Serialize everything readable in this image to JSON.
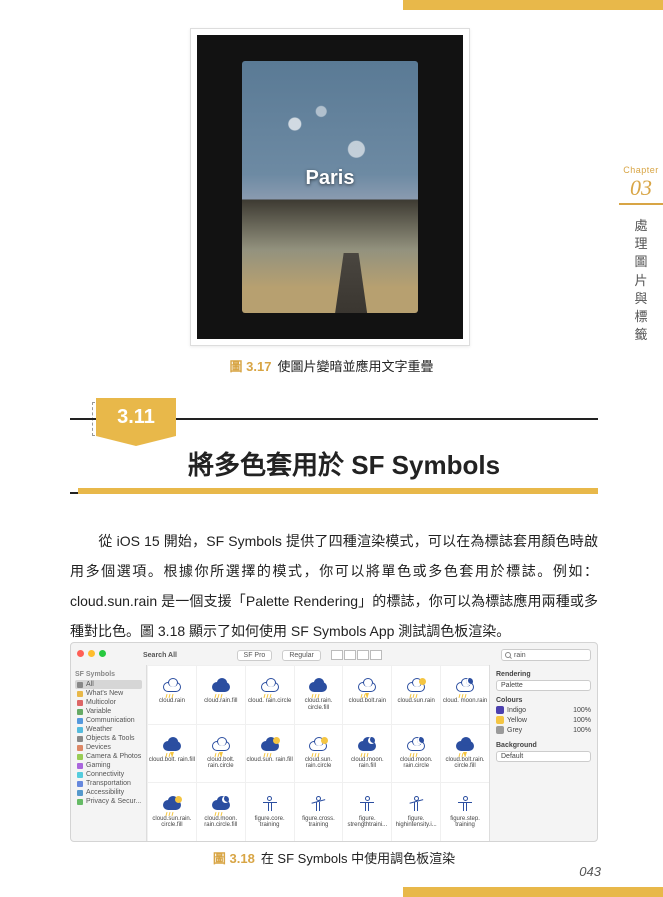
{
  "chapter": {
    "label": "Chapter",
    "num": "03",
    "title_chars": [
      "處",
      "理",
      "圖",
      "片",
      "與",
      "標",
      "籤"
    ]
  },
  "figure_3_17": {
    "overlay_text": "Paris",
    "label": "圖 3.17",
    "caption": "使圖片變暗並應用文字重疊"
  },
  "section": {
    "number": "3.11",
    "title": "將多色套用於 SF Symbols"
  },
  "body": "　　從 iOS 15 開始，SF Symbols 提供了四種渲染模式，可以在為標誌套用顏色時啟用多個選項。根據你所選擇的模式，你可以將單色或多色套用於標誌。例如：cloud.sun.rain 是一個支援「Palette Rendering」的標誌，你可以為標誌應用兩種或多種對比色。圖 3.18 顯示了如何使用 SF Symbols App 測試調色板渲染。",
  "sf_app": {
    "search_title": "Search All",
    "font": "SF Pro",
    "weight": "Regular",
    "search": "rain",
    "sidebar_header": "SF Symbols",
    "sidebar_items": [
      {
        "label": "All",
        "color": "#888",
        "selected": true
      },
      {
        "label": "What's New",
        "color": "#e8b84a"
      },
      {
        "label": "Multicolor",
        "color": "#d66"
      },
      {
        "label": "Variable",
        "color": "#6a6"
      },
      {
        "label": "Communication",
        "color": "#59d"
      },
      {
        "label": "Weather",
        "color": "#5bd"
      },
      {
        "label": "Objects & Tools",
        "color": "#888"
      },
      {
        "label": "Devices",
        "color": "#d86"
      },
      {
        "label": "Camera & Photos",
        "color": "#9c5"
      },
      {
        "label": "Gaming",
        "color": "#a6d"
      },
      {
        "label": "Connectivity",
        "color": "#5cd"
      },
      {
        "label": "Transportation",
        "color": "#68d"
      },
      {
        "label": "Accessibility",
        "color": "#59c"
      },
      {
        "label": "Privacy & Secur...",
        "color": "#6b6"
      }
    ],
    "grid": [
      {
        "name": "cloud.rain",
        "cloud": true,
        "rain": true
      },
      {
        "name": "cloud.rain.fill",
        "cloud": true,
        "rain": true,
        "fill": true
      },
      {
        "name": "cloud. rain.circle",
        "cloud": true,
        "rain": true
      },
      {
        "name": "cloud.rain. circle.fill",
        "cloud": true,
        "rain": true,
        "fill": true
      },
      {
        "name": "cloud.bolt.rain",
        "cloud": true,
        "bolt": true,
        "rain": true
      },
      {
        "name": "cloud.sun.rain",
        "cloud": true,
        "sun": true,
        "rain": true
      },
      {
        "name": "cloud. moon.rain",
        "cloud": true,
        "moon": true,
        "rain": true
      },
      {
        "name": "cloud.bolt. rain.fill",
        "cloud": true,
        "bolt": true,
        "rain": true,
        "fill": true
      },
      {
        "name": "cloud.bolt. rain.circle",
        "cloud": true,
        "bolt": true,
        "rain": true
      },
      {
        "name": "cloud.sun. rain.fill",
        "cloud": true,
        "sun": true,
        "rain": true,
        "fill": true
      },
      {
        "name": "cloud.sun. rain.circle",
        "cloud": true,
        "sun": true,
        "rain": true
      },
      {
        "name": "cloud.moon. rain.fill",
        "cloud": true,
        "moon": true,
        "rain": true,
        "fill": true
      },
      {
        "name": "cloud.moon. rain.circle",
        "cloud": true,
        "moon": true,
        "rain": true
      },
      {
        "name": "cloud.bolt.rain. circle.fill",
        "cloud": true,
        "bolt": true,
        "rain": true,
        "fill": true
      },
      {
        "name": "cloud.sun.rain. circle.fill",
        "cloud": true,
        "sun": true,
        "rain": true,
        "fill": true
      },
      {
        "name": "cloud.moon. rain.circle.fill",
        "cloud": true,
        "moon": true,
        "rain": true,
        "fill": true
      },
      {
        "name": "figure.core. training",
        "figure": true
      },
      {
        "name": "figure.cross. training",
        "figure": true,
        "arms_up": true
      },
      {
        "name": "figure. strengthtraini...",
        "figure": true
      },
      {
        "name": "figure. highintensity.i...",
        "figure": true,
        "arms_up": true
      },
      {
        "name": "figure.step. training",
        "figure": true
      }
    ],
    "right": {
      "rendering_label": "Rendering",
      "rendering": "Palette",
      "colours_label": "Colours",
      "colours": [
        {
          "name": "Indigo",
          "swatch": "#4b3fae",
          "value": "100%"
        },
        {
          "name": "Yellow",
          "swatch": "#f4c542",
          "value": "100%"
        },
        {
          "name": "Grey",
          "swatch": "#9a9a9a",
          "value": "100%"
        }
      ],
      "bg_label": "Background",
      "bg": "Default"
    }
  },
  "figure_3_18": {
    "label": "圖 3.18",
    "caption": "在 SF Symbols 中使用調色板渲染"
  },
  "page_num": "043"
}
